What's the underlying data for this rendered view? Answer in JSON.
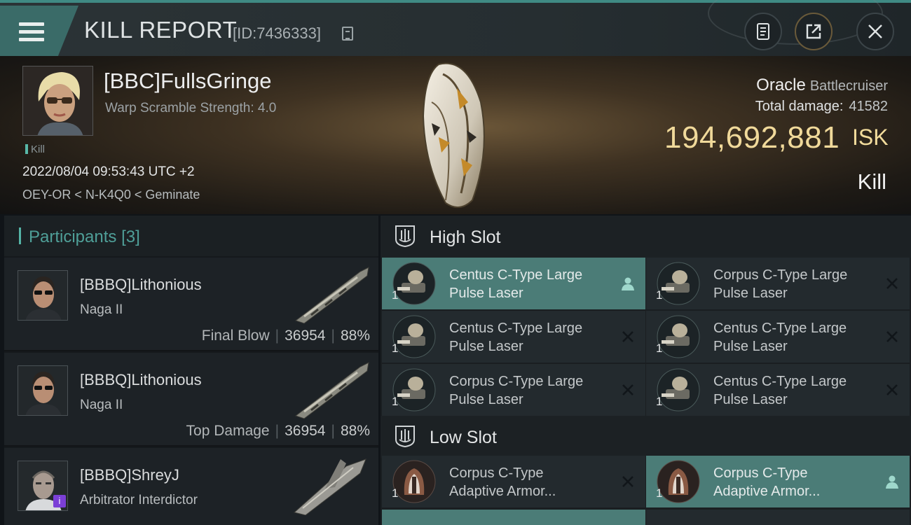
{
  "header": {
    "title": "KILL REPORT",
    "report_id": "[ID:7436333]"
  },
  "victim": {
    "name": "[BBC]FullsGringe",
    "warp_scramble": "Warp Scramble Strength: 4.0",
    "tag": "Kill",
    "timestamp": "2022/08/04 09:53:43 UTC +2",
    "location": "OEY-OR < N-K4Q0 < Geminate",
    "ship_name": "Oracle",
    "ship_class": "Battlecruiser",
    "total_damage_label": "Total damage:",
    "total_damage_value": "41582",
    "isk_value": "194,692,881",
    "isk_unit": "ISK",
    "result": "Kill"
  },
  "participants": {
    "title": "Participants",
    "count": "[3]",
    "items": [
      {
        "name": "[BBBQ]Lithonious",
        "ship": "Naga II",
        "label": "Final Blow",
        "damage": "36954",
        "percent": "88%"
      },
      {
        "name": "[BBBQ]Lithonious",
        "ship": "Naga II",
        "label": "Top Damage",
        "damage": "36954",
        "percent": "88%"
      },
      {
        "name": "[BBBQ]ShreyJ",
        "ship": "Arbitrator Interdictor",
        "badge": "i"
      }
    ]
  },
  "fitting": {
    "high_slot": {
      "title": "High Slot",
      "modules": [
        {
          "line1": "Centus C-Type Large",
          "line2": "Pulse Laser",
          "qty": "1",
          "state": "dropped"
        },
        {
          "line1": "Corpus C-Type Large",
          "line2": "Pulse Laser",
          "qty": "1",
          "state": "destroyed"
        },
        {
          "line1": "Centus C-Type Large",
          "line2": "Pulse Laser",
          "qty": "1",
          "state": "destroyed"
        },
        {
          "line1": "Centus C-Type Large",
          "line2": "Pulse Laser",
          "qty": "1",
          "state": "destroyed"
        },
        {
          "line1": "Corpus C-Type Large",
          "line2": "Pulse Laser",
          "qty": "1",
          "state": "destroyed"
        },
        {
          "line1": "Centus C-Type Large",
          "line2": "Pulse Laser",
          "qty": "1",
          "state": "destroyed"
        }
      ]
    },
    "low_slot": {
      "title": "Low Slot",
      "modules": [
        {
          "line1": "Corpus C-Type",
          "line2": "Adaptive Armor...",
          "qty": "1",
          "state": "destroyed"
        },
        {
          "line1": "Corpus C-Type",
          "line2": "Adaptive Armor...",
          "qty": "1",
          "state": "dropped"
        }
      ]
    }
  },
  "colors": {
    "accent_teal": "#4b7c77",
    "isk_gold": "#f0d99a"
  }
}
